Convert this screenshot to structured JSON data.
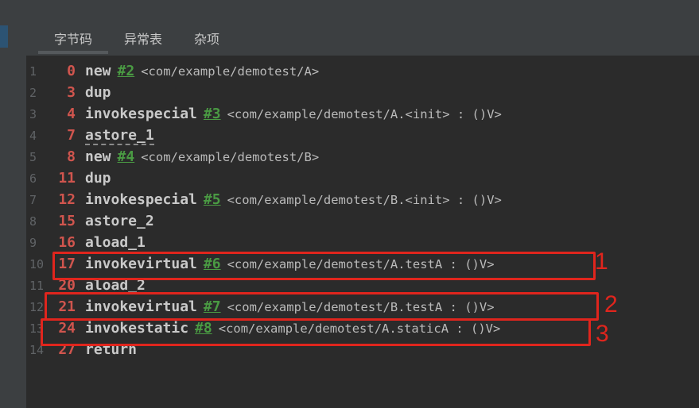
{
  "tabs": [
    {
      "label": "字节码",
      "active": true
    },
    {
      "label": "异常表",
      "active": false
    },
    {
      "label": "杂项",
      "active": false
    }
  ],
  "lines": [
    {
      "ln": "1",
      "off": "0",
      "op": "new",
      "ref": "#2",
      "cmt": "<com/example/demotest/A>"
    },
    {
      "ln": "2",
      "off": "3",
      "op": "dup",
      "ref": "",
      "cmt": ""
    },
    {
      "ln": "3",
      "off": "4",
      "op": "invokespecial",
      "ref": "#3",
      "cmt": "<com/example/demotest/A.<init> : ()V>"
    },
    {
      "ln": "4",
      "off": "7",
      "op": "astore_1",
      "ref": "",
      "cmt": ""
    },
    {
      "ln": "5",
      "off": "8",
      "op": "new",
      "ref": "#4",
      "cmt": "<com/example/demotest/B>"
    },
    {
      "ln": "6",
      "off": "11",
      "op": "dup",
      "ref": "",
      "cmt": ""
    },
    {
      "ln": "7",
      "off": "12",
      "op": "invokespecial",
      "ref": "#5",
      "cmt": "<com/example/demotest/B.<init> : ()V>"
    },
    {
      "ln": "8",
      "off": "15",
      "op": "astore_2",
      "ref": "",
      "cmt": ""
    },
    {
      "ln": "9",
      "off": "16",
      "op": "aload_1",
      "ref": "",
      "cmt": ""
    },
    {
      "ln": "10",
      "off": "17",
      "op": "invokevirtual",
      "ref": "#6",
      "cmt": "<com/example/demotest/A.testA : ()V>"
    },
    {
      "ln": "11",
      "off": "20",
      "op": "aload_2",
      "ref": "",
      "cmt": ""
    },
    {
      "ln": "12",
      "off": "21",
      "op": "invokevirtual",
      "ref": "#7",
      "cmt": "<com/example/demotest/B.testA : ()V>"
    },
    {
      "ln": "13",
      "off": "24",
      "op": "invokestatic",
      "ref": "#8",
      "cmt": "<com/example/demotest/A.staticA : ()V>"
    },
    {
      "ln": "14",
      "off": "27",
      "op": "return",
      "ref": "",
      "cmt": ""
    }
  ],
  "annotations": [
    {
      "label": "1",
      "line": "10"
    },
    {
      "label": "2",
      "line": "12"
    },
    {
      "label": "3",
      "line": "13"
    }
  ],
  "colors": {
    "window_bg": "#3c3f41",
    "editor_bg": "#2b2b2b",
    "offset": "#d0554e",
    "opcode": "#c9c9c9",
    "ref": "#4a9a43",
    "comment": "#bababa",
    "line_number": "#606366",
    "highlight": "#e0251d"
  }
}
